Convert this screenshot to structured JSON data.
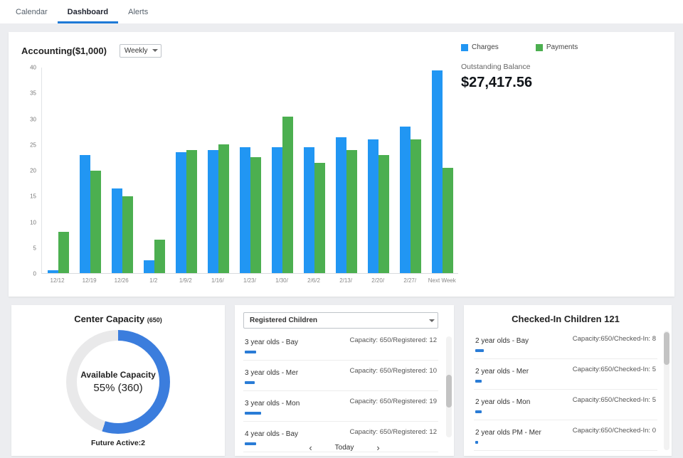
{
  "nav": {
    "tabs": [
      {
        "label": "Calendar"
      },
      {
        "label": "Dashboard"
      },
      {
        "label": "Alerts"
      }
    ],
    "active": "Dashboard"
  },
  "accounting": {
    "title": "Accounting($1,000)",
    "period_selector": "Weekly",
    "legend": [
      {
        "label": "Charges",
        "color": "#2196f3"
      },
      {
        "label": "Payments",
        "color": "#4caf50"
      }
    ],
    "outstanding_balance_label": "Outstanding Balance",
    "outstanding_balance_value": "$27,417.56"
  },
  "chart_data": {
    "type": "bar",
    "title": "Accounting($1,000)",
    "categories": [
      "12/12",
      "12/19",
      "12/26",
      "1/2",
      "1/9/2",
      "1/16/",
      "1/23/",
      "1/30/",
      "2/6/2",
      "2/13/",
      "2/20/",
      "2/27/",
      "Next Week"
    ],
    "series": [
      {
        "name": "Charges",
        "color": "#2196f3",
        "values": [
          0.5,
          23,
          16.5,
          2.5,
          23.5,
          24,
          24.5,
          24.5,
          24.5,
          26.5,
          26,
          28.5,
          39.5
        ]
      },
      {
        "name": "Payments",
        "color": "#4caf50",
        "values": [
          8,
          20,
          15,
          6.5,
          24,
          25,
          22.5,
          30.5,
          21.5,
          24,
          23,
          26,
          20.5
        ]
      }
    ],
    "xlabel": "",
    "ylabel": "",
    "ylim": [
      0,
      40
    ],
    "yticks": [
      0,
      5,
      10,
      15,
      20,
      25,
      30,
      35,
      40
    ],
    "grid": false,
    "legend_position": "top-right"
  },
  "center_capacity": {
    "title": "Center Capacity",
    "title_suffix": "(650)",
    "donut": {
      "percent": 55,
      "color": "#3b7ddd",
      "track": "#e9e9ea"
    },
    "center_label": "Available Capacity",
    "center_value": "55% (360)",
    "footer": "Future Active:2"
  },
  "registered": {
    "selector_label": "Registered Children",
    "items": [
      {
        "label": "3 year olds - Bay",
        "capacity": "Capacity: 650/Registered: 12",
        "bar": 12
      },
      {
        "label": "3 year olds - Mer",
        "capacity": "Capacity: 650/Registered: 10",
        "bar": 10
      },
      {
        "label": "3 year olds - Mon",
        "capacity": "Capacity: 650/Registered: 19",
        "bar": 19
      },
      {
        "label": "4 year olds - Bay",
        "capacity": "Capacity: 650/Registered: 12",
        "bar": 12
      }
    ],
    "pagination": {
      "prev": "‹",
      "today": "Today",
      "next": "›"
    }
  },
  "checked_in": {
    "title": "Checked-In Children 121",
    "items": [
      {
        "label": "2 year olds - Bay",
        "capacity": "Capacity:650/Checked-In: 8",
        "bar": 8
      },
      {
        "label": "2 year olds - Mer",
        "capacity": "Capacity:650/Checked-In: 5",
        "bar": 5
      },
      {
        "label": "2 year olds - Mon",
        "capacity": "Capacity:650/Checked-In: 5",
        "bar": 5
      },
      {
        "label": "2 year olds PM - Mer",
        "capacity": "Capacity:650/Checked-In: 0",
        "bar": 0
      }
    ]
  },
  "colors": {
    "progress": "#2a7cd6",
    "active_tab": "#1e7ad6"
  }
}
